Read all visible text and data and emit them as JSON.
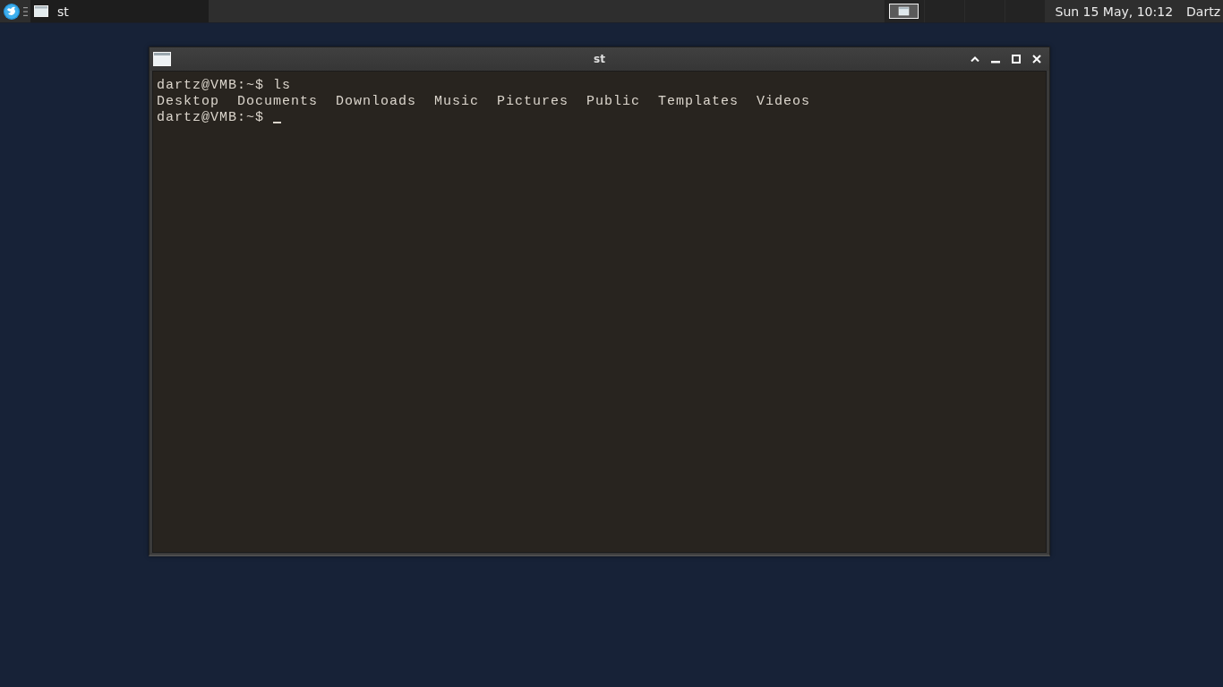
{
  "taskbar": {
    "tasks": [
      {
        "title": "st",
        "selected": true
      }
    ],
    "pager": {
      "workspaces": [
        {
          "has_window": true
        },
        {
          "has_window": false
        },
        {
          "has_window": false
        },
        {
          "has_window": false
        }
      ]
    },
    "clock": "Sun 15 May, 10:12",
    "user": "Dartz"
  },
  "window": {
    "title": "st",
    "terminal": {
      "lines": [
        {
          "kind": "prompt",
          "prompt": "dartz@VMB:~$",
          "command": "ls",
          "cursor": false
        },
        {
          "kind": "listing",
          "entries": [
            "Desktop",
            "Documents",
            "Downloads",
            "Music",
            "Pictures",
            "Public",
            "Templates",
            "Videos"
          ]
        },
        {
          "kind": "prompt",
          "prompt": "dartz@VMB:~$",
          "cursor": true
        }
      ]
    }
  }
}
